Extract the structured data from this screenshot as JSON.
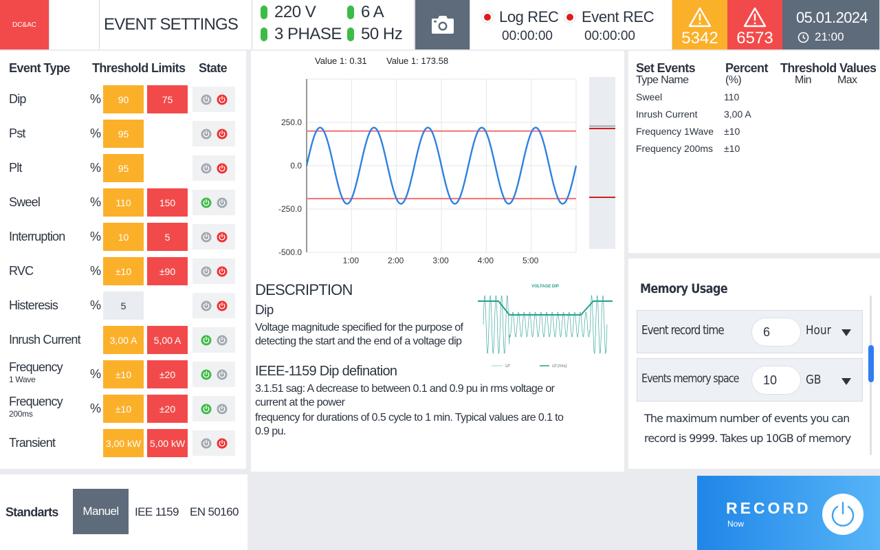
{
  "header": {
    "logo": "DC&AC",
    "title": "EVENT SETTINGS",
    "voltage": "220 V",
    "phase": "3 PHASE",
    "current": "6 A",
    "frequency": "50 Hz",
    "log_rec_label": "Log REC",
    "log_rec_time": "00:00:00",
    "event_rec_label": "Event REC",
    "event_rec_time": "00:00:00",
    "warning_orange_count": "5342",
    "warning_red_count": "6573",
    "date": "05.01.2024",
    "time": "21:00",
    "colors": {
      "orange": "#fbb02a",
      "red": "#f24a4a",
      "slate": "#5e6b7b",
      "green": "#3dbb47"
    }
  },
  "event_table": {
    "col_event_type": "Event Type",
    "col_threshold": "Threshold Limits",
    "col_state": "State",
    "rows": [
      {
        "name": "Dip",
        "sub": "",
        "pct": "%",
        "v1": "90",
        "v2": "75",
        "v1_color": "orange",
        "v2_color": "red",
        "s1": "gray",
        "s2": "red"
      },
      {
        "name": "Pst",
        "sub": "",
        "pct": "%",
        "v1": "95",
        "v2": "",
        "v1_color": "orange",
        "v2_color": "",
        "s1": "gray",
        "s2": "red"
      },
      {
        "name": "Plt",
        "sub": "",
        "pct": "%",
        "v1": "95",
        "v2": "",
        "v1_color": "orange",
        "v2_color": "",
        "s1": "gray",
        "s2": "red"
      },
      {
        "name": "Sweel",
        "sub": "",
        "pct": "%",
        "v1": "110",
        "v2": "150",
        "v1_color": "orange",
        "v2_color": "red",
        "s1": "green",
        "s2": "gray"
      },
      {
        "name": "Interruption",
        "sub": "",
        "pct": "%",
        "v1": "10",
        "v2": "5",
        "v1_color": "orange",
        "v2_color": "red",
        "s1": "gray",
        "s2": "red"
      },
      {
        "name": "RVC",
        "sub": "",
        "pct": "%",
        "v1": "±10",
        "v2": "±90",
        "v1_color": "orange",
        "v2_color": "red",
        "s1": "gray",
        "s2": "red"
      },
      {
        "name": "Histeresis",
        "sub": "",
        "pct": "%",
        "v1": "5",
        "v2": "",
        "v1_color": "gray",
        "v2_color": "",
        "s1": "gray",
        "s2": "red"
      },
      {
        "name": "Inrush Current",
        "sub": "",
        "pct": "",
        "v1": "3,00 A",
        "v2": "5,00 A",
        "v1_color": "orange",
        "v2_color": "red",
        "s1": "green",
        "s2": "gray"
      },
      {
        "name": "Frequency",
        "sub": "1 Wave",
        "pct": "%",
        "v1": "±10",
        "v2": "±20",
        "v1_color": "orange",
        "v2_color": "red",
        "s1": "green",
        "s2": "gray"
      },
      {
        "name": "Frequency",
        "sub": "200ms",
        "pct": "%",
        "v1": "±10",
        "v2": "±20",
        "v1_color": "orange",
        "v2_color": "red",
        "s1": "green",
        "s2": "gray"
      },
      {
        "name": "Transient",
        "sub": "",
        "pct": "",
        "v1": "3,00 kW",
        "v2": "5,00 kW",
        "v1_color": "orange",
        "v2_color": "red",
        "s1": "gray",
        "s2": "red"
      }
    ]
  },
  "chart_data": {
    "type": "line",
    "value_labels": [
      "Value 1: 0.31",
      "Value 1: 173.58"
    ],
    "x_ticks": [
      "1:00",
      "2:00",
      "3:00",
      "4:00",
      "5:00"
    ],
    "y_ticks": [
      "250.0",
      "0.0",
      "-250.0",
      "-500.0"
    ],
    "ylim": [
      -500,
      500
    ],
    "series": [
      {
        "type": "sine",
        "amplitude": 220,
        "cycles": 5,
        "color": "#2f80e0"
      }
    ],
    "threshold_lines": [
      200,
      -190
    ],
    "threshold_color": "#f07070",
    "grid": true
  },
  "description": {
    "heading": "DESCRIPTION",
    "event_name": "Dip",
    "text": "Voltage magnitude specified for the purpose of detecting the start and the end of a voltage  dip",
    "ieee_heading": "IEEE-1159 Dip defination",
    "ieee_text_1": "3.1.51 sag: A decrease to between 0.1 and 0.9 pu in rms voltage or current at the power",
    "ieee_text_2": "frequency for durations of 0.5 cycle to 1 min. Typical values are 0.1 to 0.9 pu.",
    "thumb_title": "VOLTAGE DIP",
    "thumb_legend_1": "Uf",
    "thumb_legend_2": "Uf (rms)"
  },
  "set_events": {
    "col_set": "Set Events",
    "col_type": "Type Name",
    "col_percent": "Percent",
    "col_percent_sub": "(%)",
    "col_threshold": "Threshold Values",
    "col_min": "Min",
    "col_max": "Max",
    "rows": [
      {
        "name": "Sweel",
        "percent": "110"
      },
      {
        "name": "Inrush Current",
        "percent": "3,00 A"
      },
      {
        "name": "Frequency 1Wave",
        "percent": "±10"
      },
      {
        "name": "Frequency 200ms",
        "percent": "±10"
      }
    ]
  },
  "memory": {
    "title": "Memory Usage",
    "event_time_label": "Event record time",
    "event_time_value": "6",
    "event_time_unit": "Hour",
    "space_label": "Events memory space",
    "space_value": "10",
    "space_unit": "GB",
    "note": "The maximum number of events you can record is 9999. Takes up 10GB of memory"
  },
  "standards": {
    "label": "Standarts",
    "options": [
      "Manuel",
      "IEE 1159",
      "EN 50160"
    ],
    "selected": "Manuel"
  },
  "record": {
    "label": "RECORD",
    "sub": "Now"
  }
}
